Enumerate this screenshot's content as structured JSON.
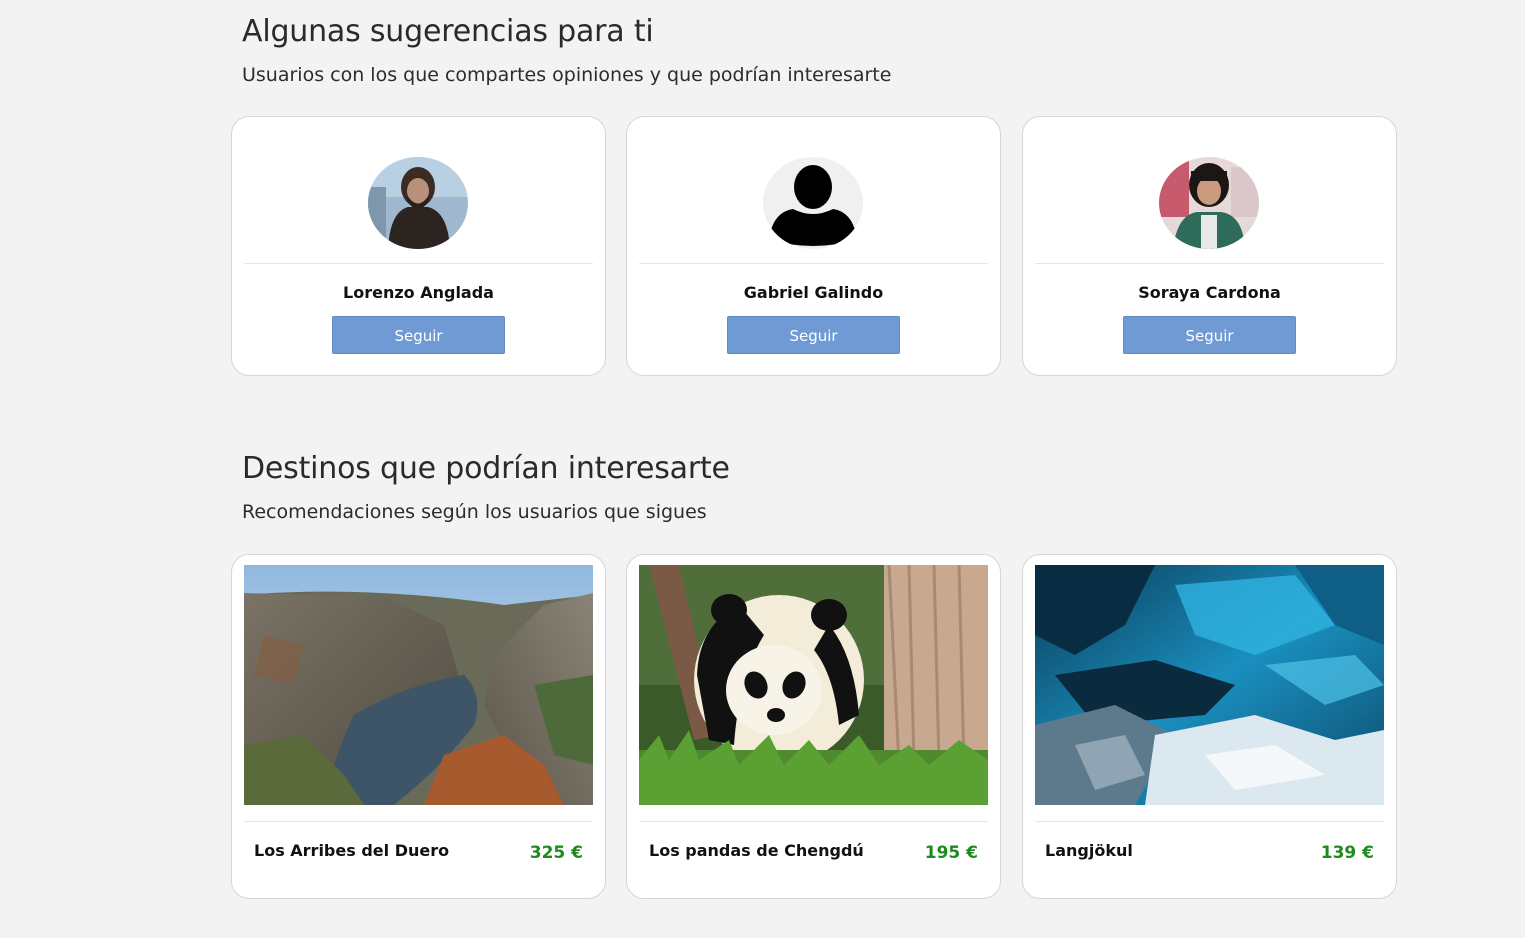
{
  "suggestions": {
    "title": "Algunas sugerencias para ti",
    "subtitle": "Usuarios con los que compartes opiniones y que podrían interesarte",
    "users": [
      {
        "name": "Lorenzo Anglada",
        "follow_label": "Seguir",
        "avatar": "photo-avatar-man-fur-coat"
      },
      {
        "name": "Gabriel Galindo",
        "follow_label": "Seguir",
        "avatar": "default-user-silhouette"
      },
      {
        "name": "Soraya Cardona",
        "follow_label": "Seguir",
        "avatar": "illustrated-avatar-woman-green-jacket"
      }
    ]
  },
  "destinations": {
    "title": "Destinos que podrían interesarte",
    "subtitle": "Recomendaciones según los usuarios que sigues",
    "items": [
      {
        "name": "Los Arribes del Duero",
        "price": "325 €",
        "image": "canyon-river-landscape"
      },
      {
        "name": "Los pandas de Chengdú",
        "price": "195 €",
        "image": "giant-panda-photo"
      },
      {
        "name": "Langjökul",
        "price": "139 €",
        "image": "blue-ice-cave-photo"
      }
    ]
  },
  "colors": {
    "background": "#f3f3f3",
    "follow_button": "#6f9ad3",
    "price": "#1e8a1e"
  }
}
